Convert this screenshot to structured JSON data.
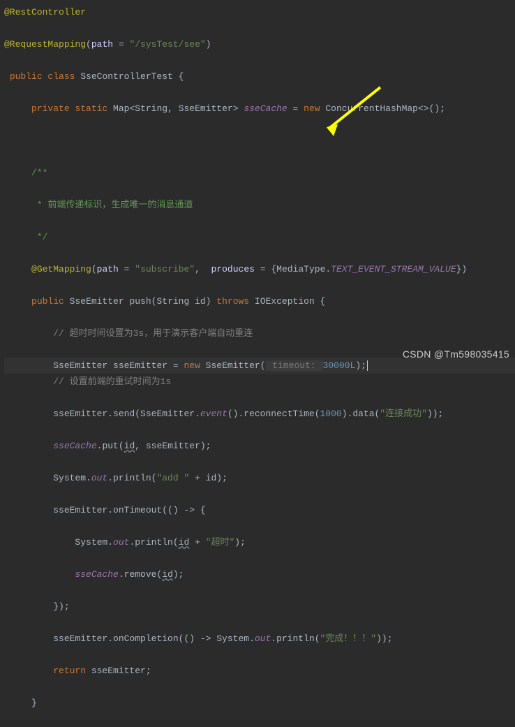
{
  "line1_anno": "@RestController",
  "line2_anno": "@RequestMapping",
  "line2_attr": "path",
  "line2_eq": " = ",
  "line2_val": "\"/sysTest/see\"",
  "line3_kw1": "public class ",
  "line3_cls": "SseControllerTest ",
  "line4_kw1": "private static ",
  "line4_type": "Map",
  "line4_gen1": "<",
  "line4_t1": "String",
  "line4_c1": ", ",
  "line4_t2": "SseEmitter",
  "line4_gen2": "> ",
  "line4_field": "sseCache",
  "line4_eq": " = ",
  "line4_new": "new ",
  "line4_ctor": "ConcurrentHashMap",
  "line4_end": "<>();",
  "doc1": "/**",
  "doc2": " * 前端传递标识，生成唯一的消息通道",
  "doc3": " */",
  "gm_anno": "@GetMapping",
  "gm_attr1": "path",
  "gm_eq1": " = ",
  "gm_val1": "\"subscribe\"",
  "gm_c": ",  ",
  "gm_attr2": "produces",
  "gm_eq2": " = {",
  "gm_mt": "MediaType.",
  "gm_const": "TEXT_EVENT_STREAM_VALUE",
  "gm_end": "})",
  "push_kw": "public ",
  "push_ret": "SseEmitter ",
  "push_name": "push",
  "push_p1": "(String id) ",
  "push_throws": "throws ",
  "push_exc": "IOException {",
  "c1": "// 超时时间设置为3s，用于演示客户端自动重连",
  "em_decl": "SseEmitter sseEmitter = ",
  "em_new": "new ",
  "em_ctor": "SseEmitter(",
  "em_hint": " timeout: ",
  "em_val": "30000L",
  "em_end": ");",
  "c2": "// 设置前端的重试时间为1s",
  "send_a": "sseEmitter.send(SseEmitter.",
  "send_ev": "event",
  "send_b": "().reconnectTime(",
  "send_n": "1000",
  "send_c": ").data(",
  "send_s": "\"连接成功\"",
  "send_d": "));",
  "put_a": "sseCache",
  "put_b": ".put(",
  "put_id": "id",
  "put_c": ", sseEmitter);",
  "pr1_a": "System.",
  "pr1_out": "out",
  "pr1_b": ".println(",
  "pr1_s": "\"add \"",
  "pr1_c": " + id);",
  "ot_a": "sseEmitter.onTimeout(() -> {",
  "ot_pr_a": "System.",
  "ot_pr_out": "out",
  "ot_pr_b": ".println(",
  "ot_pr_id": "id",
  "ot_pr_c": " + ",
  "ot_pr_s": "\"超时\"",
  "ot_pr_d": ");",
  "ot_rm_a": "sseCache",
  "ot_rm_b": ".remove(",
  "ot_rm_id": "id",
  "ot_rm_c": ");",
  "ot_close": "});",
  "oc_a": "sseEmitter.onCompletion(() -> System.",
  "oc_out": "out",
  "oc_b": ".println(",
  "oc_s": "\"完成！！！\"",
  "oc_c": "));",
  "ret_kw": "return ",
  "ret_v": "sseEmitter;",
  "close": "}",
  "watermark": "CSDN @Tm598035415"
}
